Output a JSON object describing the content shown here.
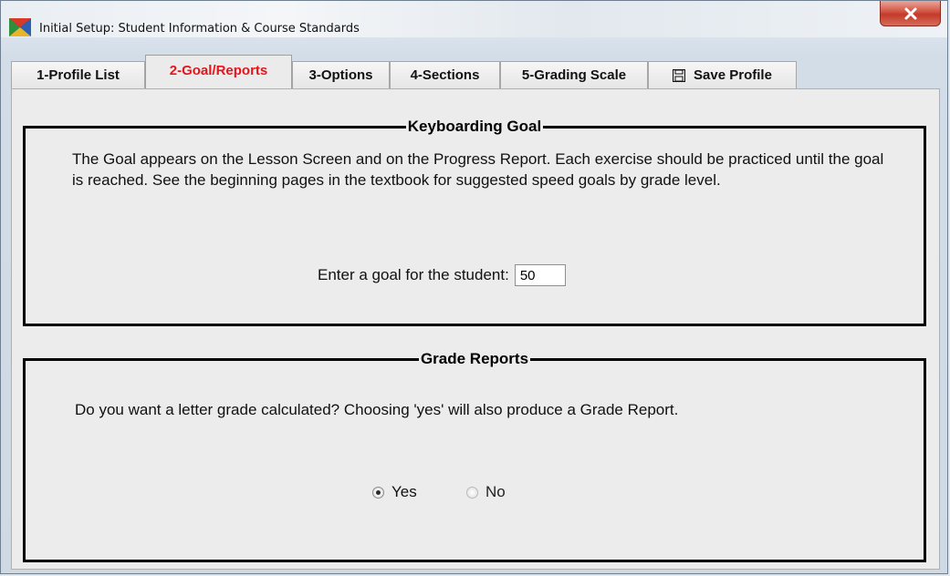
{
  "window": {
    "title": "Initial Setup: Student Information & Course Standards"
  },
  "icons": {
    "app": "app-icon",
    "close": "close-icon",
    "save": "floppy-disk-icon"
  },
  "tabs": [
    {
      "label": "1-Profile List",
      "active": false
    },
    {
      "label": "2-Goal/Reports",
      "active": true
    },
    {
      "label": "3-Options",
      "active": false
    },
    {
      "label": "4-Sections",
      "active": false
    },
    {
      "label": "5-Grading Scale",
      "active": false
    },
    {
      "label": "Save Profile",
      "active": false
    }
  ],
  "keyboarding_goal": {
    "heading": "Keyboarding Goal",
    "description": "The Goal appears on the Lesson Screen and on the Progress Report. Each exercise should be practiced until the goal is reached. See the beginning pages in the textbook for suggested speed goals by grade level.",
    "goal_label": "Enter a goal for the student:",
    "goal_value": "50"
  },
  "grade_reports": {
    "heading": "Grade Reports",
    "question": "Do you want a letter grade calculated? Choosing 'yes' will also produce a Grade Report.",
    "options": [
      {
        "label": "Yes",
        "selected": true
      },
      {
        "label": "No",
        "selected": false
      }
    ]
  },
  "colors": {
    "active_tab_text": "#e8141b",
    "close_button": "#c33a2a"
  }
}
